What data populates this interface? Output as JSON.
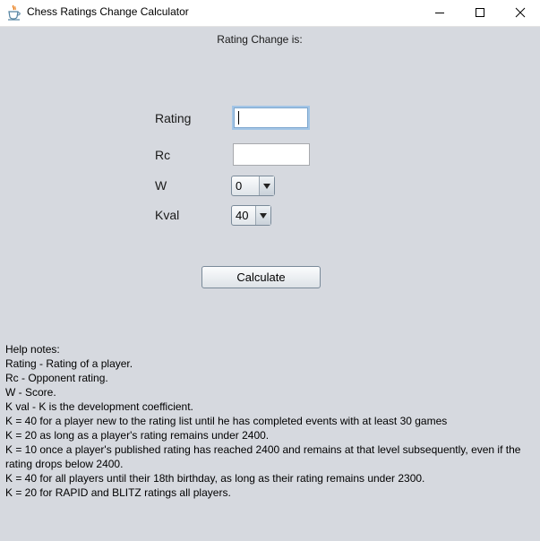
{
  "window": {
    "title": "Chess Ratings Change Calculator",
    "minimize_icon": "minimize-icon",
    "maximize_icon": "maximize-icon",
    "close_icon": "close-icon",
    "app_icon": "java-coffee-cup-icon"
  },
  "result": {
    "label": "Rating Change is:"
  },
  "form": {
    "rating_label": "Rating",
    "rating_value": "",
    "rc_label": "Rc",
    "rc_value": "",
    "w_label": "W",
    "w_selected": "0",
    "kval_label": "Kval",
    "kval_selected": "40",
    "dropdown_icon": "triangle-down-icon"
  },
  "actions": {
    "calculate_label": "Calculate"
  },
  "help": {
    "lines": [
      "Help notes:",
      "Rating - Rating of a player.",
      "Rc - Opponent rating.",
      "W - Score.",
      "K val - K is the development coefficient.",
      "K = 40 for a player new to the rating list until he has completed events with at least 30 games",
      "K = 20 as long as a player's rating remains under 2400.",
      "K = 10 once a player's published rating has reached 2400 and remains at that level subsequently, even if the rating drops below 2400.",
      "K = 40 for all players until their 18th birthday, as long as their rating remains under 2300.",
      "K = 20 for RAPID and BLITZ ratings all players."
    ]
  }
}
